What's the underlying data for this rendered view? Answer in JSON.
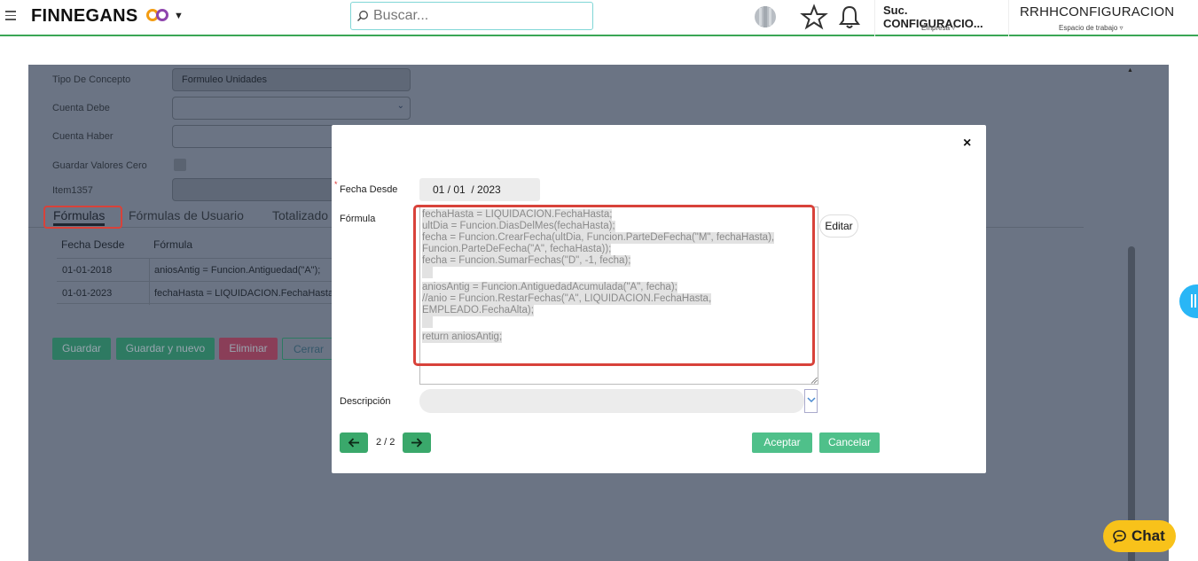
{
  "header": {
    "logo_text": "FINNEGANS",
    "search_placeholder": "Buscar...",
    "company": {
      "name": "Suc. CONFIGURACIO...",
      "label": "Empresa ▿"
    },
    "workspace": {
      "name": "RRHHCONFIGURACION",
      "label": "Espacio de trabajo ▿"
    },
    "colors": {
      "brand_green": "#3aa655",
      "search_border": "#7fd6d6"
    }
  },
  "background_form": {
    "fields": [
      {
        "label": "Tipo De Concepto",
        "value": "Formuleo Unidades"
      },
      {
        "label": "Cuenta Debe",
        "value": ""
      },
      {
        "label": "Cuenta Haber",
        "value": ""
      },
      {
        "label": "Guardar Valores Cero",
        "value": ""
      },
      {
        "label": "Item1357",
        "value": ""
      }
    ],
    "tabs": [
      "Fórmulas",
      "Fórmulas de Usuario",
      "Totalizado"
    ],
    "active_tab": "Fórmulas",
    "table": {
      "headers": [
        "Fecha Desde",
        "Fórmula"
      ],
      "rows": [
        [
          "01-01-2018",
          "aniosAntig = Funcion.Antiguedad(\"A\");"
        ],
        [
          "01-01-2023",
          "fechaHasta = LIQUIDACION.FechaHasta;"
        ]
      ]
    },
    "buttons": [
      "Guardar",
      "Guardar y nuevo",
      "Eliminar",
      "Cerrar"
    ]
  },
  "modal": {
    "close": "×",
    "fecha_desde_label": "Fecha Desde",
    "required_mark": "*",
    "fecha_desde_value": "01 / 01  / 2023",
    "formula_label": "Fórmula",
    "formula_lines": [
      "fechaHasta = LIQUIDACION.FechaHasta;",
      "ultDia = Funcion.DiasDelMes(fechaHasta);",
      "fecha = Funcion.CrearFecha(ultDia, Funcion.ParteDeFecha(\"M\", fechaHasta),",
      "Funcion.ParteDeFecha(\"A\", fechaHasta));",
      "fecha = Funcion.SumarFechas(\"D\", -1, fecha);",
      "",
      "aniosAntig = Funcion.AntiguedadAcumulada(\"A\", fecha);",
      "//anio = Funcion.RestarFechas(\"A\", LIQUIDACION.FechaHasta,",
      "EMPLEADO.FechaAlta);",
      "",
      "return aniosAntig;"
    ],
    "edit_button": "Editar",
    "descripcion_label": "Descripción",
    "pager": "2 / 2",
    "accept_button": "Aceptar",
    "cancel_button": "Cancelar"
  },
  "chat": {
    "label": "Chat",
    "color": "#f8c21a"
  }
}
